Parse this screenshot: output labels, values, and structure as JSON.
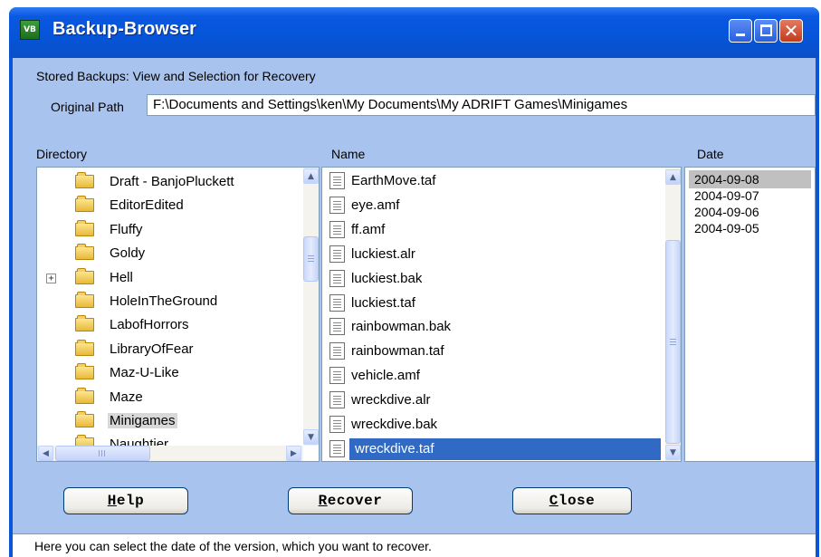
{
  "window": {
    "title": "Backup-Browser",
    "icon_text": "VB"
  },
  "subtitle": "Stored Backups: View and Selection for Recovery",
  "path": {
    "label": "Original Path",
    "value": "F:\\Documents and Settings\\ken\\My Documents\\My ADRIFT Games\\Minigames"
  },
  "columns": {
    "directory": "Directory",
    "name": "Name",
    "date": "Date"
  },
  "directories": [
    {
      "label": "Draft - BanjoPluckett",
      "expandable": false,
      "selected": false
    },
    {
      "label": "EditorEdited",
      "expandable": false,
      "selected": false
    },
    {
      "label": "Fluffy",
      "expandable": false,
      "selected": false
    },
    {
      "label": "Goldy",
      "expandable": false,
      "selected": false
    },
    {
      "label": "Hell",
      "expandable": true,
      "selected": false
    },
    {
      "label": "HoleInTheGround",
      "expandable": false,
      "selected": false
    },
    {
      "label": "LabofHorrors",
      "expandable": false,
      "selected": false
    },
    {
      "label": "LibraryOfFear",
      "expandable": false,
      "selected": false
    },
    {
      "label": "Maz-U-Like",
      "expandable": false,
      "selected": false
    },
    {
      "label": "Maze",
      "expandable": false,
      "selected": false
    },
    {
      "label": "Minigames",
      "expandable": false,
      "selected": true
    },
    {
      "label": "Naughtier",
      "expandable": false,
      "selected": false
    }
  ],
  "files": [
    {
      "name": "EarthMove.taf",
      "selected": false
    },
    {
      "name": "eye.amf",
      "selected": false
    },
    {
      "name": "ff.amf",
      "selected": false
    },
    {
      "name": "luckiest.alr",
      "selected": false
    },
    {
      "name": "luckiest.bak",
      "selected": false
    },
    {
      "name": "luckiest.taf",
      "selected": false
    },
    {
      "name": "rainbowman.bak",
      "selected": false
    },
    {
      "name": "rainbowman.taf",
      "selected": false
    },
    {
      "name": "vehicle.amf",
      "selected": false
    },
    {
      "name": "wreckdive.alr",
      "selected": false
    },
    {
      "name": "wreckdive.bak",
      "selected": false
    },
    {
      "name": "wreckdive.taf",
      "selected": true
    }
  ],
  "dates": [
    {
      "value": "2004-09-08",
      "selected": true
    },
    {
      "value": "2004-09-07",
      "selected": false
    },
    {
      "value": "2004-09-06",
      "selected": false
    },
    {
      "value": "2004-09-05",
      "selected": false
    }
  ],
  "buttons": {
    "help": {
      "first": "H",
      "rest": "elp"
    },
    "recover": {
      "first": "R",
      "rest": "ecover"
    },
    "close": {
      "first": "C",
      "rest": "lose"
    }
  },
  "status_text": "Here you can select the date of the version, which you want to recover.",
  "colors": {
    "titlebar": "#0a56d8",
    "client_bg": "#a9c3ef",
    "selection": "#316ac5"
  }
}
